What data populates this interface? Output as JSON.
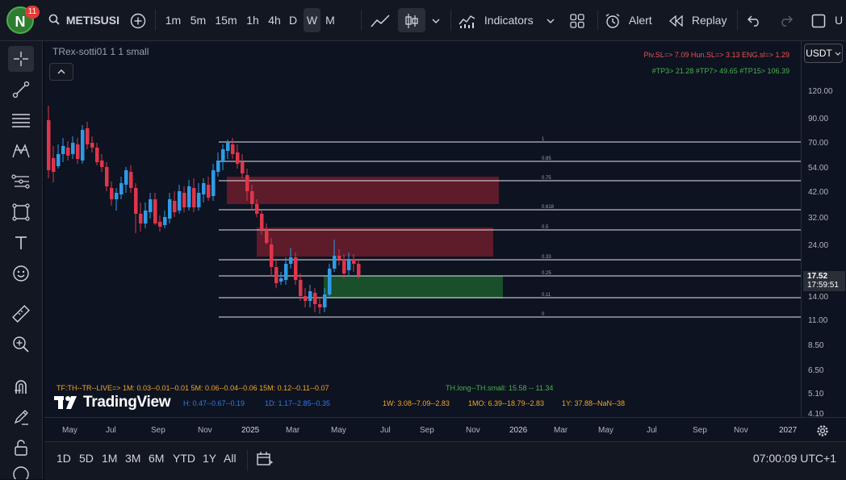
{
  "header": {
    "avatar_letter": "N",
    "notification_count": "11",
    "symbol": "METISUSI",
    "intervals": [
      "1m",
      "5m",
      "15m",
      "1h",
      "4h",
      "D",
      "W",
      "M"
    ],
    "active_interval": "W",
    "indicators_label": "Indicators",
    "alert_label": "Alert",
    "replay_label": "Replay",
    "overflow_label": "U"
  },
  "chart": {
    "legend_title": "TRex-sotti01 1 1 small",
    "currency": "USDT",
    "info_line1": "Piv.SL=> 7.09  Hun.SL=> 3.13  ENG.sl=> 1.29",
    "info_line2": "#TP3> 21.28  #TP7> 49.65  #TP15> 106.39",
    "tf_line": "TF:TH--TR--LIVE=>  1M: 0.03--0.01--0.01   5M: 0.06--0.04--0.06   15M: 0.12--0.11--0.07",
    "th_line": "TH.long--TH.small: 15.58 -- 11.34",
    "h_line": "H: 0.47--0.67--0.19",
    "d_line": "1D: 1.17--2.85--0.35",
    "w_line": "1W: 3.08--7.09--2.83",
    "mo_line": "1MO: 6.39--18.79--2.83",
    "y_line": "1Y: 37.88--NaN--38",
    "logo_text": "TradingView",
    "last_price": "17.52",
    "countdown": "17:59:51",
    "fib_levels": [
      "1",
      "0.85",
      "0.75",
      "0.618",
      "0.5",
      "0.33",
      "0.25",
      "0.11",
      "0"
    ],
    "price_labels": [
      "120.00",
      "90.00",
      "70.00",
      "54.00",
      "42.00",
      "32.00",
      "24.00",
      "14.00",
      "11.00",
      "8.50",
      "6.50",
      "5.10",
      "4.10"
    ],
    "time_labels": [
      "May",
      "Jul",
      "Sep",
      "Nov",
      "2025",
      "Mar",
      "May",
      "Jul",
      "Sep",
      "Nov",
      "2026",
      "Mar",
      "May",
      "Jul",
      "Sep",
      "Nov",
      "2027"
    ]
  },
  "bottom": {
    "ranges": [
      "1D",
      "5D",
      "1M",
      "3M",
      "6M",
      "YTD",
      "1Y",
      "All"
    ],
    "clock": "07:00:09 UTC+1"
  },
  "colors": {
    "bull": "#2e9be6",
    "bear": "#e0354b",
    "zone_red": "#7a1f2e",
    "zone_green": "#1c5a2c",
    "info_red": "#ef5350",
    "info_green": "#4caf50",
    "info_orange": "#f5a623",
    "info_blue": "#2f7bea"
  }
}
